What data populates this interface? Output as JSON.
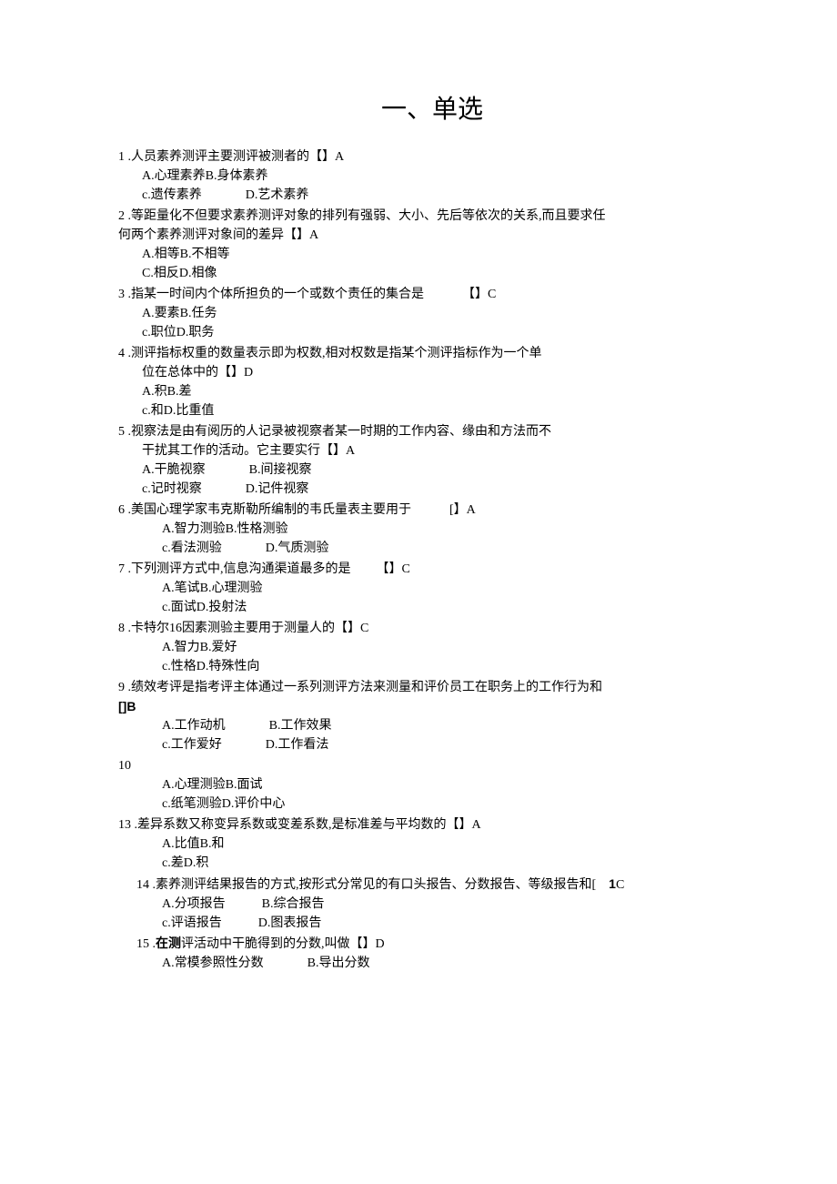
{
  "title": "一、单选",
  "q1": {
    "stem": "1 .人员素养测评主要测评被测者的【】A",
    "optA": "A.心理素养B.身体素养",
    "optC": "c.遗传素养",
    "optD": "D.艺术素养"
  },
  "q2": {
    "stem1": "2 .等距量化不但要求素养测评对象的排列有强弱、大小、先后等依次的关系,而且要求任",
    "stem2": "何两个素养测评对象间的差异【】A",
    "optA": "A.相等B.不相等",
    "optC": "C.相反D.相像"
  },
  "q3": {
    "stem": "3 .指某一时间内个体所担负的一个或数个责任的集合是   【】C",
    "optA": "A.要素B.任务",
    "optC": "c.职位D.职务"
  },
  "q4": {
    "stem1": "4 .测评指标权重的数量表示即为权数,相对权数是指某个测评指标作为一个单",
    "stem2": "位在总体中的【】D",
    "optA": "A.积B.差",
    "optC": "c.和D.比重值"
  },
  "q5": {
    "stem1": "5 .视察法是由有阅历的人记录被视察者某一时期的工作内容、缘由和方法而不",
    "stem2": "干扰其工作的活动。它主要实行【】A",
    "optA": "A.干脆视察",
    "optB": "B.间接视察",
    "optC": "c.记时视察",
    "optD": "D.记件视察"
  },
  "q6": {
    "stem": "6 .美国心理学家韦克斯勒所编制的韦氏量表主要用于   [】A",
    "optA": "A.智力测验B.性格测验",
    "optC": "c.看法测验",
    "optD": "D.气质测验"
  },
  "q7": {
    "stem": "7 .下列测评方式中,信息沟通渠道最多的是  【】C",
    "optA": "A.笔试B.心理测验",
    "optC": "c.面试D.投射法"
  },
  "q8": {
    "stem": "8 .卡特尔16因素测验主要用于测量人的【】C",
    "optA": "A.智力B.爱好",
    "optC": "c.性格D.特殊性向"
  },
  "q9": {
    "stem": "9 .绩效考评是指考评主体通过一系列测评方法来测量和评价员工在职务上的工作行为和",
    "bracket": "[]B",
    "optA": "A.工作动机",
    "optB": "B.工作效果",
    "optC": "c.工作爱好",
    "optD": "D.工作看法"
  },
  "q10": {
    "stem": "10",
    "optA": "A.心理测验B.面试",
    "optC": "c.纸笔测验D.评价中心"
  },
  "q13": {
    "stem": "13 .差异系数又称变异系数或变差系数,是标准差与平均数的【】A",
    "optA": "A.比值B.和",
    "optC": "c.差D.积"
  },
  "q14": {
    "stem_pre": "14 .素养测评结果报告的方式,按形式分常见的有口头报告、分数报告、等级报告和[ ",
    "stem_bold": "1",
    "stem_post": "C",
    "optA": "A.分项报告",
    "optB": "B.综合报告",
    "optC": "c.评语报告",
    "optD": "D.图表报告"
  },
  "q15": {
    "stem_pre": "15 .",
    "stem_bold": "在测",
    "stem_post": "评活动中干脆得到的分数,叫做【】D",
    "optA": "A.常模参照性分数",
    "optB": "B.导出分数"
  }
}
